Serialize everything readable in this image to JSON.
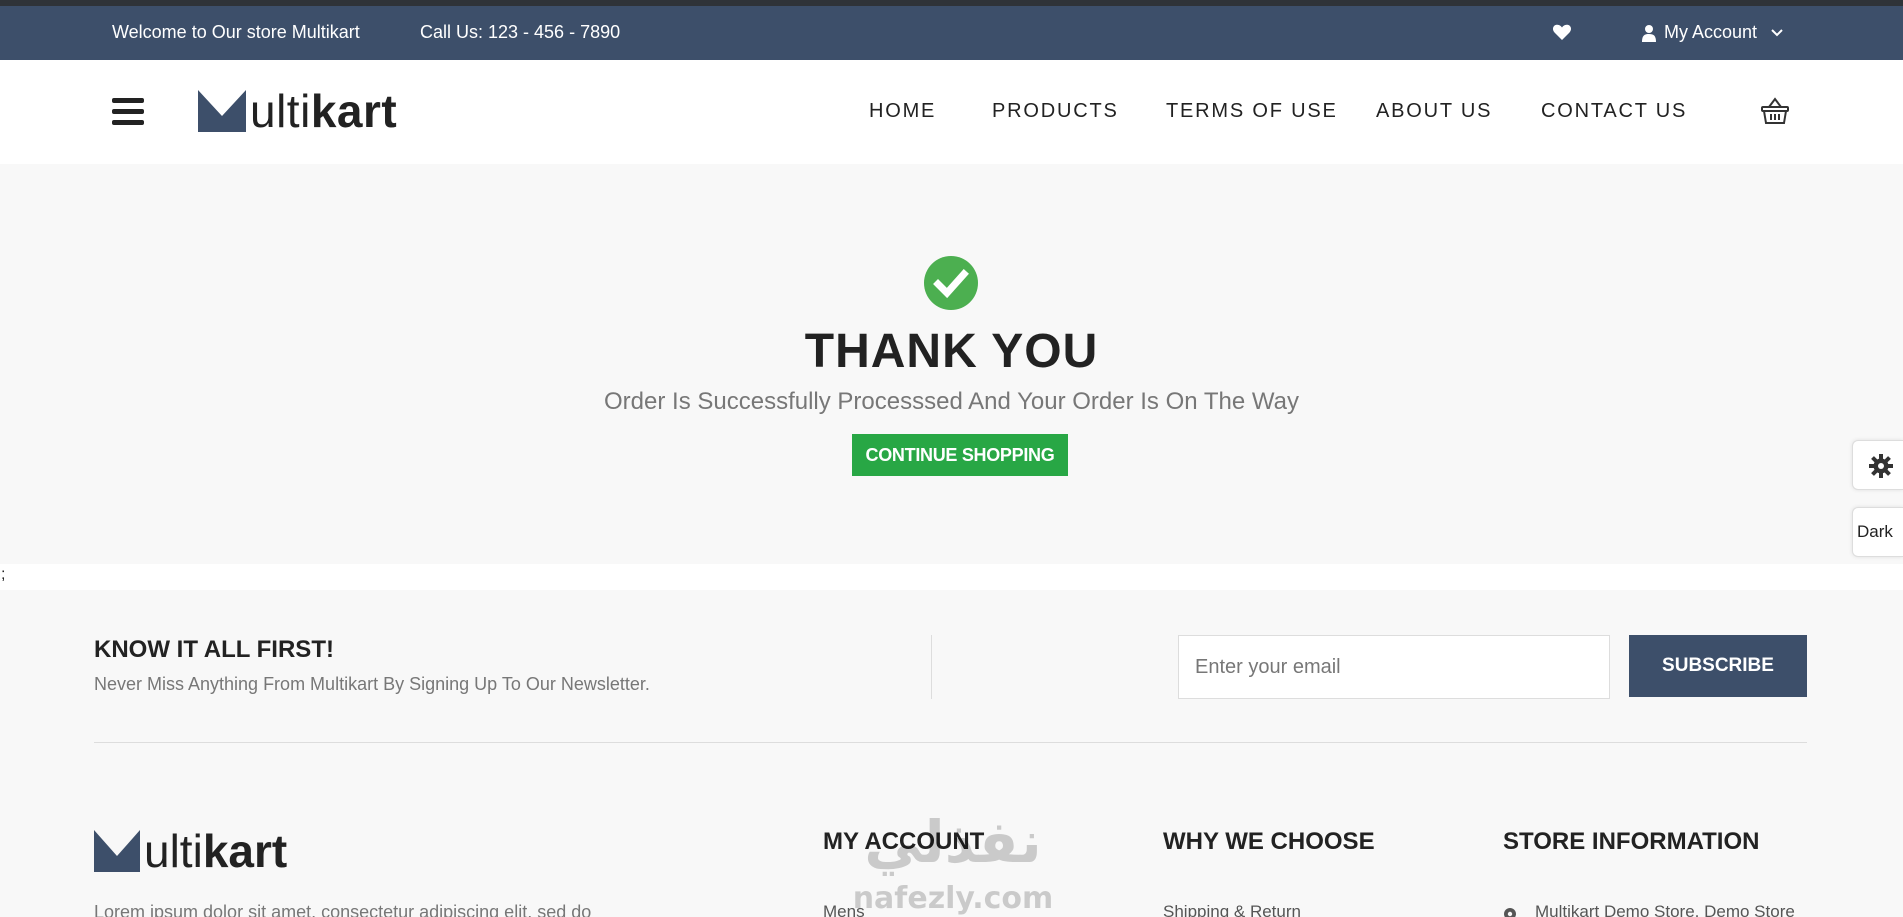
{
  "topbar": {
    "welcome": "Welcome to Our store Multikart",
    "call": "Call Us: 123 - 456 - 7890",
    "account": "My Account"
  },
  "logo": {
    "prefix": "ulti",
    "bold": "kart"
  },
  "nav": {
    "items": [
      "HOME",
      "PRODUCTS",
      "TERMS OF USE",
      "ABOUT US",
      "CONTACT US"
    ]
  },
  "hero": {
    "title": "THANK YOU",
    "subtitle": "Order Is Successfully Processsed And Your Order Is On The Way",
    "button": "CONTINUE SHOPPING",
    "check_color": "#4caf50",
    "button_color": "#28a745"
  },
  "side": {
    "dark_label": "Dark"
  },
  "stray_text": ";",
  "newsletter": {
    "title": "KNOW IT ALL FIRST!",
    "subtitle": "Never Miss Anything From Multikart By Signing Up To Our Newsletter.",
    "email_placeholder": "Enter your email",
    "button": "SUBSCRIBE"
  },
  "footer": {
    "about_text": "Lorem ipsum dolor sit amet, consectetur adipiscing elit, sed do",
    "columns": [
      {
        "title": "MY ACCOUNT",
        "first_item": "Mens"
      },
      {
        "title": "WHY WE CHOOSE",
        "first_item": "Shipping & Return"
      },
      {
        "title": "STORE INFORMATION",
        "first_item": "Multikart Demo Store, Demo Store"
      }
    ]
  },
  "watermark": {
    "arabic": "نفذلي",
    "latin": "nafezly.com"
  },
  "colors": {
    "topbar": "#3d4f6a",
    "accent": "#3d4f6a"
  }
}
